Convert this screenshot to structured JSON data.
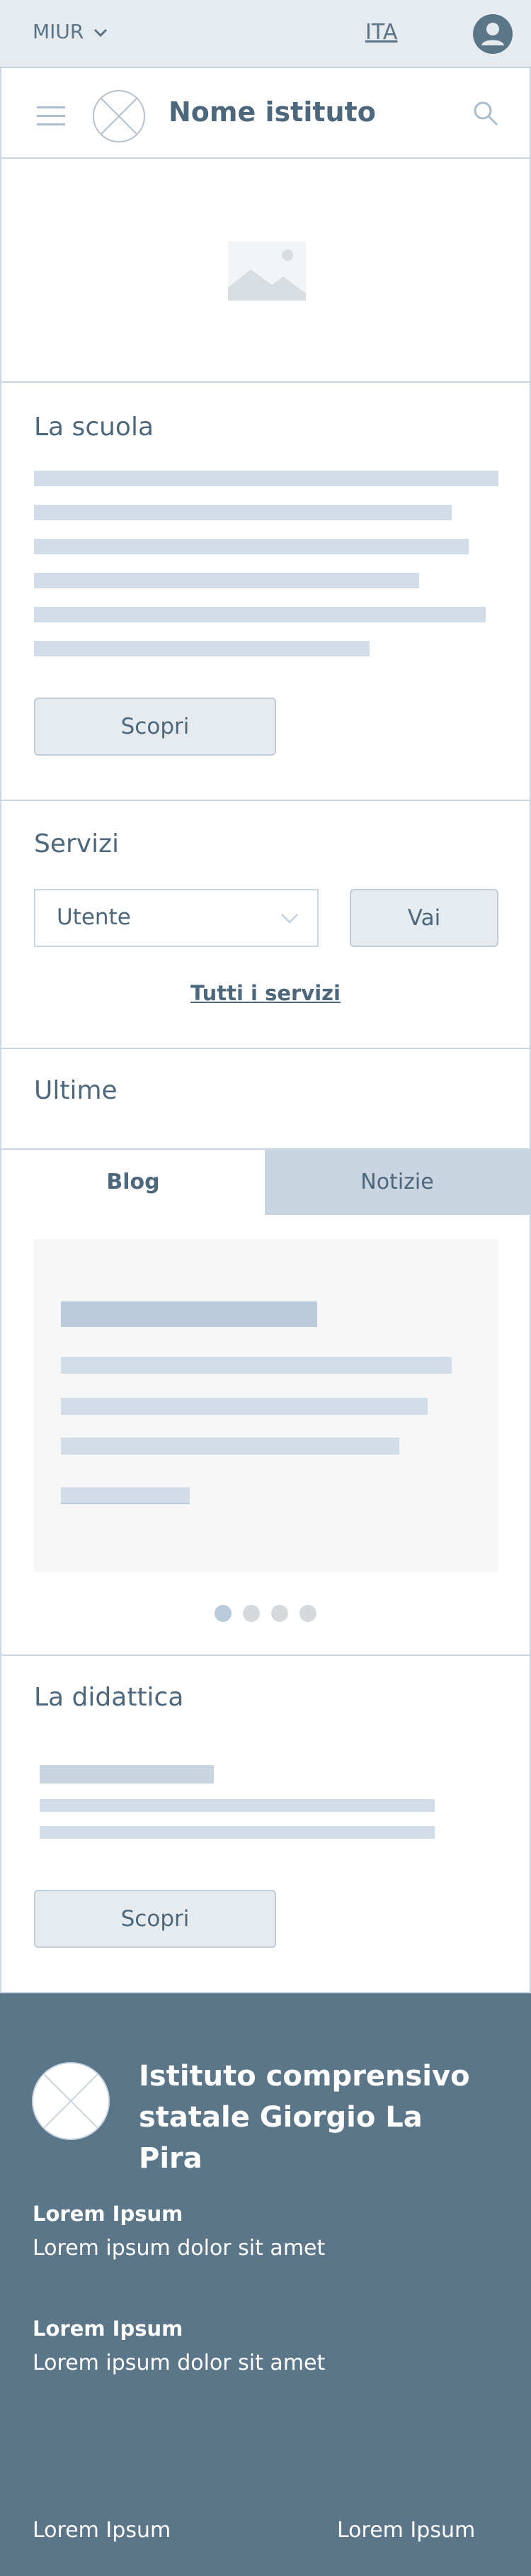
{
  "topbar": {
    "org": "MIUR",
    "language": "ITA"
  },
  "header": {
    "school_name": "Nome istituto"
  },
  "scuola": {
    "title": "La scuola",
    "button": "Scopri"
  },
  "servizi": {
    "title": "Servizi",
    "select_value": "Utente",
    "go_button": "Vai",
    "all_link": "Tutti i servizi"
  },
  "ultime": {
    "title": "Ultime",
    "tabs": [
      "Blog",
      "Notizie"
    ],
    "active_tab": "Blog",
    "carousel_pages": 4,
    "carousel_active": 1
  },
  "didattica": {
    "title": "La didattica",
    "button": "Scopri"
  },
  "footer": {
    "title": "Istituto comprensivo statale Giorgio La Pira",
    "blocks": [
      {
        "heading": "Lorem Ipsum",
        "text": "Lorem ipsum dolor sit amet"
      },
      {
        "heading": "Lorem Ipsum",
        "text": "Lorem ipsum dolor sit amet"
      }
    ],
    "links": [
      "Lorem Ipsum",
      "Lorem Ipsum"
    ]
  },
  "colors": {
    "brand": "#5b7689",
    "placeholder": "#d2dde8",
    "surface": "#e6ebf0",
    "active_tab_bg": "#c9d6e2"
  },
  "icons": [
    "chevron-down-icon",
    "user-icon",
    "menu-icon",
    "logo-placeholder-icon",
    "search-icon",
    "image-placeholder-icon",
    "dropdown-chevron-icon"
  ]
}
